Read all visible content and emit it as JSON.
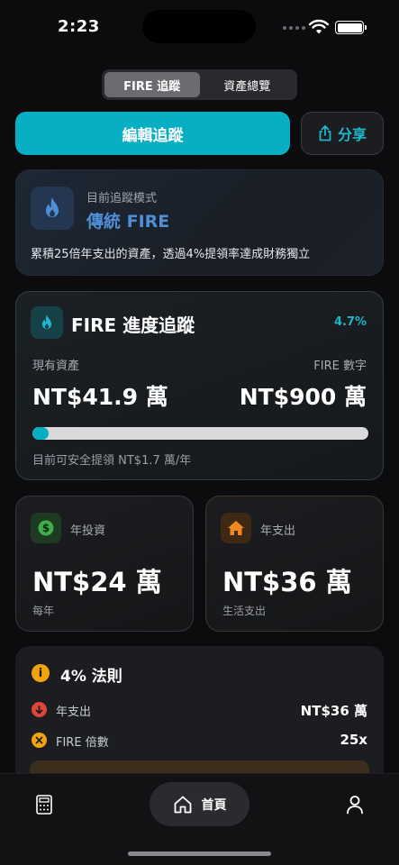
{
  "status_bar": {
    "time": "2:23"
  },
  "segmented": {
    "tabs": [
      {
        "label": "FIRE 追蹤",
        "active": true
      },
      {
        "label": "資產總覽",
        "active": false
      }
    ]
  },
  "actions": {
    "edit_label": "編輯追蹤",
    "share_label": "分享"
  },
  "mode_card": {
    "subtitle": "目前追蹤模式",
    "title": "傳統 FIRE",
    "description": "累積25倍年支出的資產，透過4%提領率達成財務獨立",
    "icon": "flame-icon"
  },
  "progress_card": {
    "title": "FIRE 進度追蹤",
    "percent": "4.7%",
    "progress_fraction": 0.047,
    "current_label": "現有資產",
    "current_value": "NT$41.9 萬",
    "target_label": "FIRE 數字",
    "target_value": "NT$900 萬",
    "footnote": "目前可安全提領 NT$1.7 萬/年",
    "accent": "#08aec4"
  },
  "invest_card": {
    "label": "年投資",
    "value": "NT$24 萬",
    "footnote": "每年",
    "icon": "dollar-icon",
    "color": "#3fae4a"
  },
  "expense_card": {
    "label": "年支出",
    "value": "NT$36 萬",
    "footnote": "生活支出",
    "icon": "house-icon",
    "color": "#f08a1c"
  },
  "rule_card": {
    "title": "4% 法則",
    "rows": [
      {
        "label": "年支出",
        "value": "NT$36 萬",
        "icon": "arrow-down-icon",
        "color": "#e0443a"
      },
      {
        "label": "FIRE 倍數",
        "value": "25x",
        "icon": "multiply-icon",
        "color": "#f2a40e"
      }
    ]
  },
  "tab_bar": {
    "home_label": "首頁",
    "left_icon": "calculator-icon",
    "right_icon": "person-icon"
  }
}
